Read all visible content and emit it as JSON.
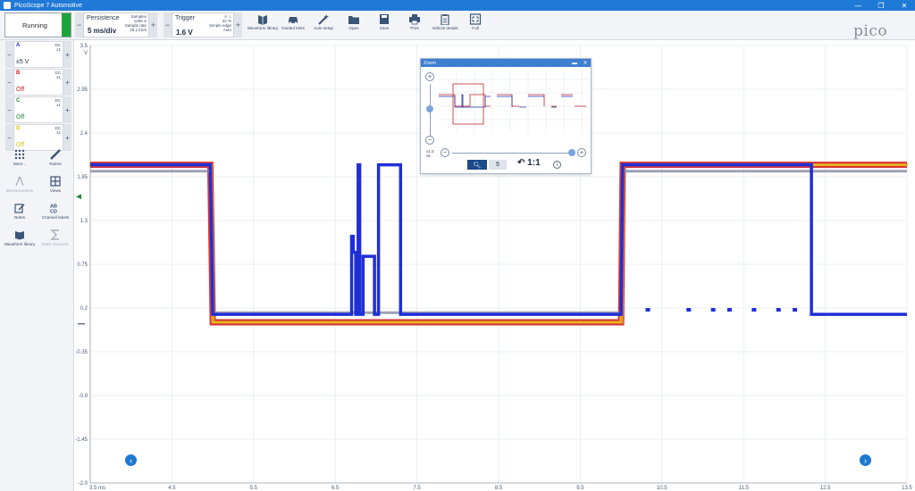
{
  "window": {
    "title": "PicoScope 7 Automotive",
    "controls": [
      "—",
      "❐",
      "✕"
    ]
  },
  "toolbar": {
    "run_label": "Running",
    "timebase": {
      "title": "Persistence",
      "value": "5 ms/div",
      "samples_label": "Samples",
      "samples_value": "1255 S",
      "rate_label": "Sample rate",
      "rate_value": "25.1 kS/s"
    },
    "trigger": {
      "title": "Trigger",
      "value": "1.6 V",
      "mode_label": "Simple edge",
      "mode_value": "Auto",
      "channel": "A",
      "percent": "22 %"
    },
    "tools": [
      {
        "label": "Waveform library",
        "icon": "book-icon"
      },
      {
        "label": "Guided tests",
        "icon": "car-icon"
      },
      {
        "label": "Auto setup",
        "icon": "wand-icon"
      },
      {
        "label": "Open",
        "icon": "folder-icon"
      },
      {
        "label": "Save",
        "icon": "save-icon"
      },
      {
        "label": "Print",
        "icon": "print-icon"
      },
      {
        "label": "Vehicle details",
        "icon": "clipboard-icon"
      },
      {
        "label": "Full",
        "icon": "fullscreen-icon"
      }
    ],
    "logo": "pico",
    "logo_sub": "Technology"
  },
  "channels": [
    {
      "name": "A",
      "coupling": "DC",
      "probe": "x1",
      "range": "±5 V",
      "color": "#1f2fd8"
    },
    {
      "name": "B",
      "coupling": "DC",
      "probe": "x1",
      "range": "Off",
      "color": "#d21e1e"
    },
    {
      "name": "C",
      "coupling": "DC",
      "probe": "x1",
      "range": "Off",
      "color": "#1f8a3a"
    },
    {
      "name": "D",
      "coupling": "DC",
      "probe": "x1",
      "range": "Off",
      "color": "#d8c21a"
    }
  ],
  "left_tools": [
    {
      "label": "More...",
      "icon": "grid-dots-icon",
      "enabled": true
    },
    {
      "label": "Rulers",
      "icon": "ruler-icon",
      "enabled": true
    },
    {
      "label": "Measurements",
      "icon": "measure-icon",
      "enabled": false
    },
    {
      "label": "Views",
      "icon": "views-icon",
      "enabled": true
    },
    {
      "label": "Notes",
      "icon": "notes-icon",
      "enabled": true
    },
    {
      "label": "Channel labels",
      "icon": "abcd-icon",
      "enabled": true
    },
    {
      "label": "Waveform library",
      "icon": "waveform-library-icon",
      "enabled": true
    },
    {
      "label": "Math channels",
      "icon": "sigma-icon",
      "enabled": false
    }
  ],
  "chart_data": {
    "type": "line",
    "ylabel": "V",
    "y_ticks": [
      "3.5",
      "2.95",
      "2.4",
      "1.85",
      "1.3",
      "0.75",
      "0.2",
      "-0.35",
      "-0.9",
      "-1.45",
      "-2.0"
    ],
    "ylim": [
      -2.0,
      3.5
    ],
    "x_ticks": [
      "3.5 ms",
      "4.5",
      "5.5",
      "6.5",
      "7.5",
      "8.5",
      "9.5",
      "10.5",
      "11.5",
      "12.5",
      "13.5"
    ],
    "xlim": [
      3.5,
      13.5
    ],
    "persistence_colors": [
      "#d21e1e",
      "#f0a020",
      "#e0d020"
    ],
    "series": [
      {
        "color": "#1f2fd8",
        "x": [
          3.5,
          4.97,
          5.0,
          6.7,
          6.7,
          6.72,
          6.72,
          6.75,
          6.75,
          6.78,
          6.78,
          6.8,
          6.8,
          6.84,
          6.84,
          6.98,
          6.98,
          7.03,
          7.03,
          7.3,
          7.3,
          7.35,
          7.35,
          10.0,
          10.02,
          12.33,
          12.33,
          13.5
        ],
        "y": [
          2.0,
          2.0,
          0.12,
          0.12,
          1.1,
          1.1,
          0.9,
          0.9,
          0.12,
          0.12,
          2.0,
          2.0,
          0.12,
          0.12,
          0.85,
          0.85,
          0.12,
          0.12,
          2.0,
          2.0,
          0.12,
          0.12,
          0.12,
          0.12,
          2.0,
          2.0,
          0.12,
          0.12
        ]
      }
    ]
  },
  "zoom": {
    "title": "Zoom",
    "ratio": "1:1",
    "x_label": "x1.0",
    "y_label": "x5"
  }
}
